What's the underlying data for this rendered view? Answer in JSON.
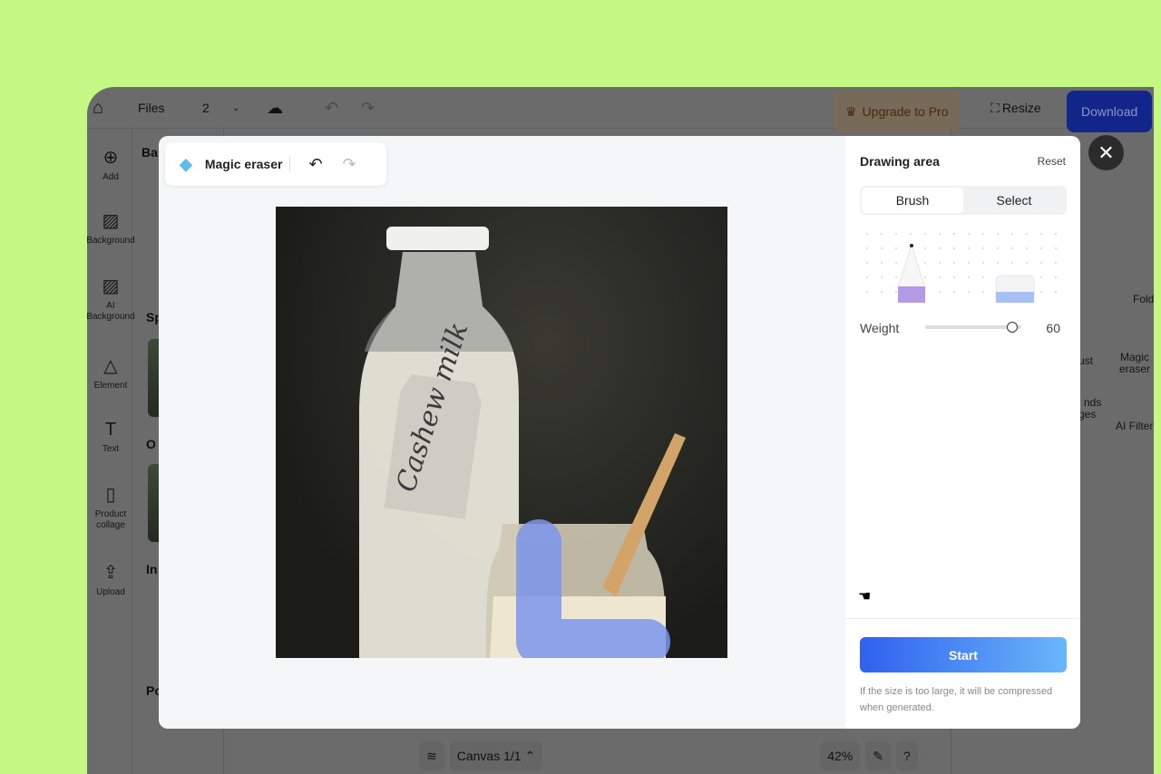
{
  "topbar": {
    "files": "Files",
    "page_count": "2",
    "upgrade": "Upgrade to Pro",
    "resize": "Resize",
    "download": "Download"
  },
  "rail": [
    {
      "label": "Add",
      "icon": "plus-circle-icon"
    },
    {
      "label": "Background",
      "icon": "background-icon"
    },
    {
      "label": "AI Background",
      "icon": "ai-background-icon"
    },
    {
      "label": "Element",
      "icon": "shapes-icon"
    },
    {
      "label": "Text",
      "icon": "text-icon"
    },
    {
      "label": "Product collage",
      "icon": "collage-icon"
    },
    {
      "label": "Upload",
      "icon": "upload-icon"
    }
  ],
  "panel_headings": [
    "Ba",
    "Sp",
    "O",
    "In",
    "Po"
  ],
  "right_panel": {
    "fold": "Fold",
    "tools": [
      "ust",
      "Magic eraser",
      "l nds ges",
      "AI Filter"
    ]
  },
  "bottombar": {
    "canvas": "Canvas 1/1",
    "zoom": "42%",
    "help": "?"
  },
  "modal": {
    "title": "Magic eraser",
    "side": {
      "heading": "Drawing area",
      "reset": "Reset",
      "tabs": [
        "Brush",
        "Select"
      ],
      "active_tab": "Brush",
      "weight_label": "Weight",
      "weight_value": 60,
      "weight_max": 100,
      "start": "Start",
      "note": "If the size is too large, it will be compressed when generated."
    },
    "photo": {
      "tag_text": "Cashew milk"
    },
    "brush_color": "#7b95ec"
  },
  "colors": {
    "background": "#c5f784",
    "accent": "#1f47e0",
    "start_gradient_from": "#2f61ee",
    "start_gradient_to": "#6ab6fa"
  }
}
